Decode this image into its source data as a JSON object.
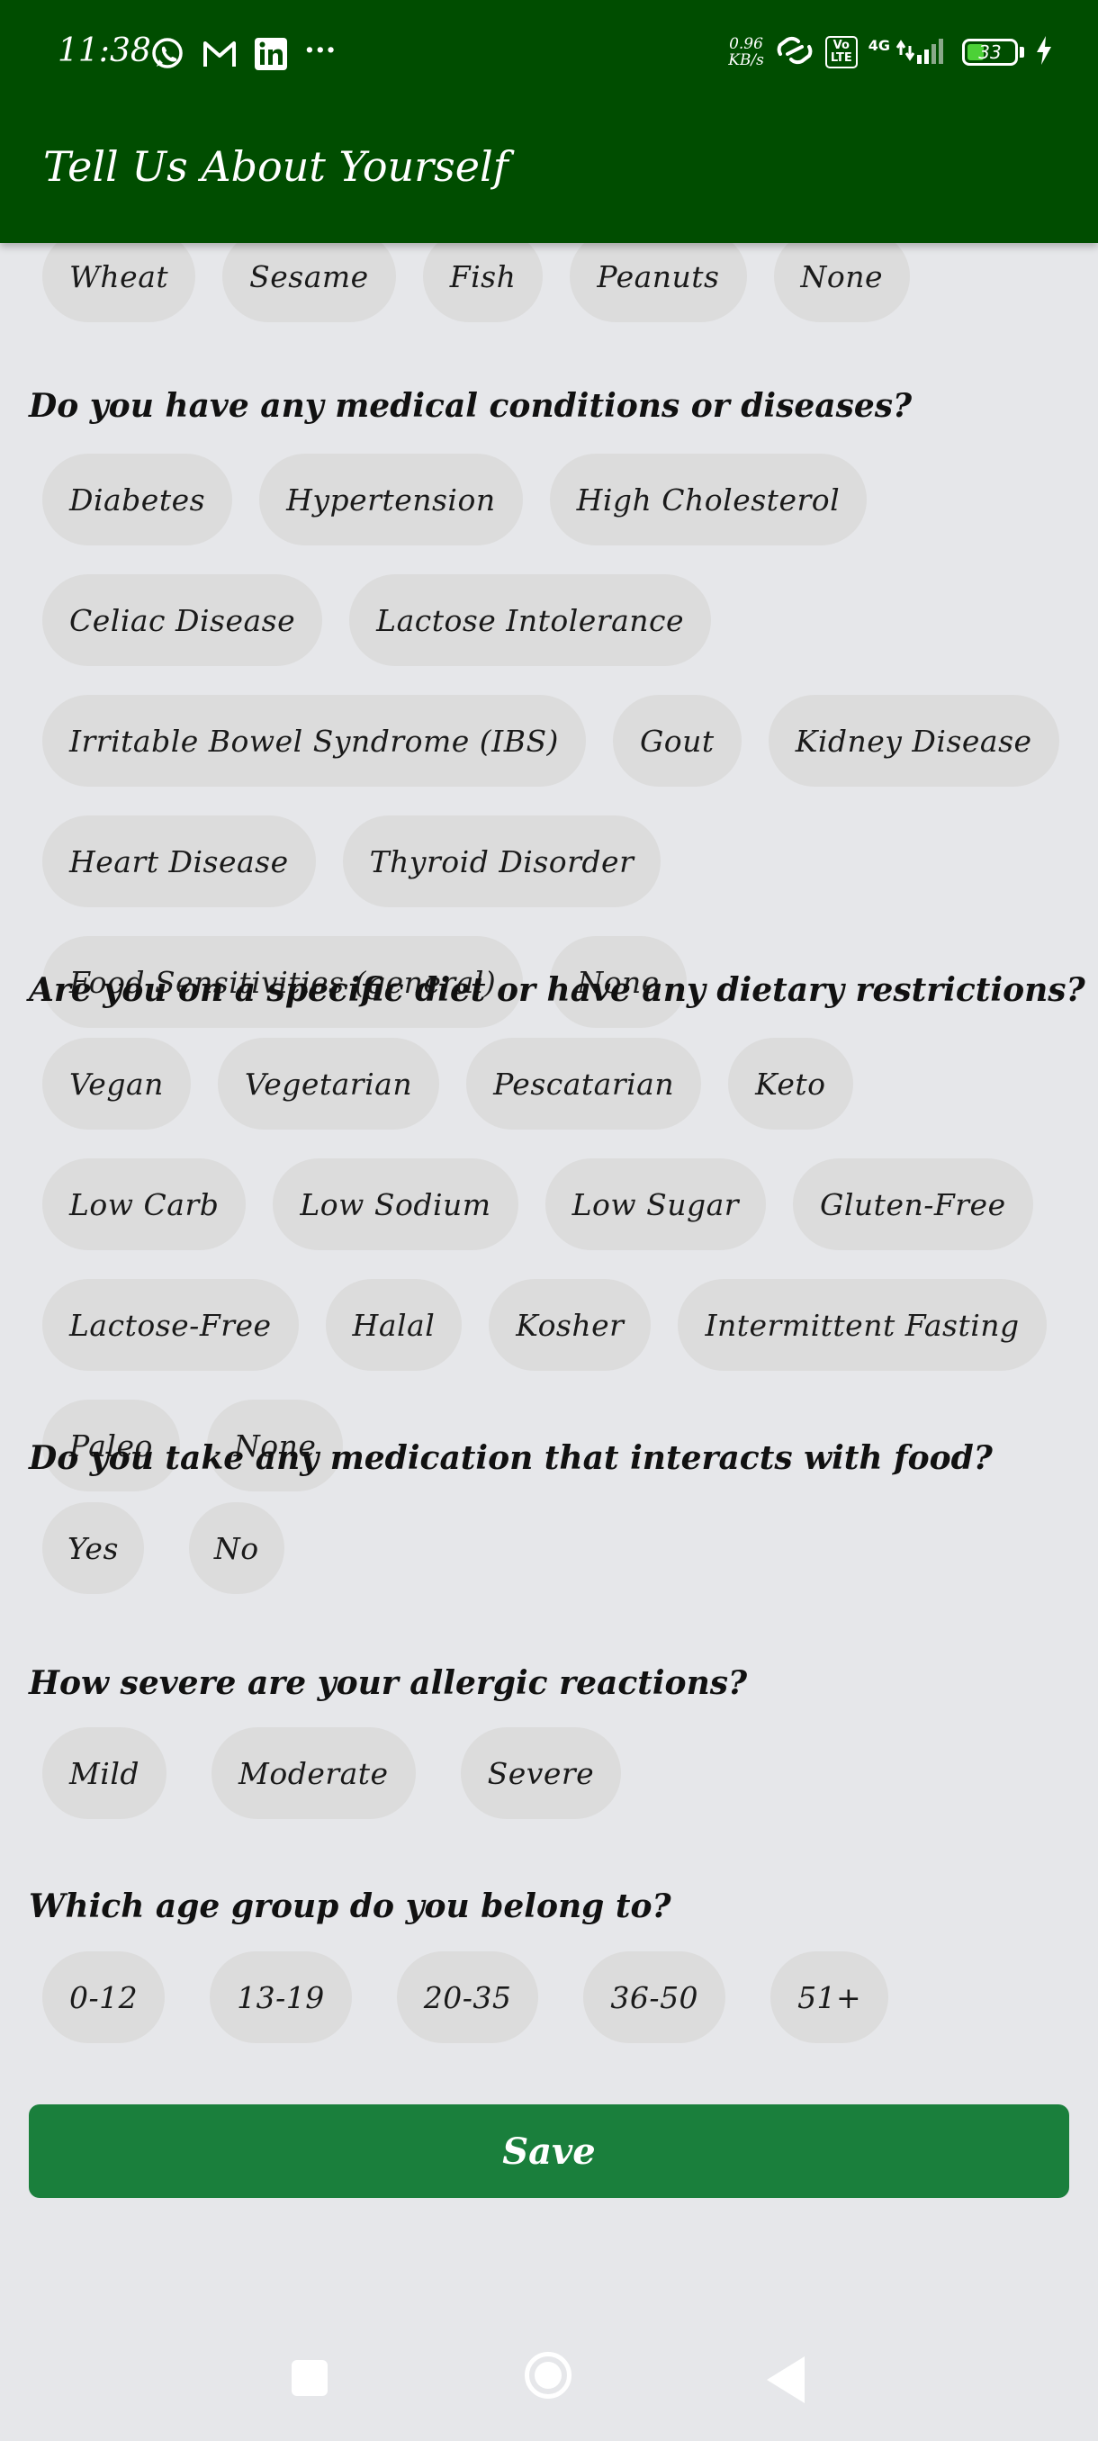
{
  "status_bar": {
    "time": "11:38",
    "more": "···",
    "net_speed_value": "0.96",
    "net_speed_unit": "KB/s",
    "volte_top": "Vo",
    "volte_bottom": "LTE",
    "network": "4G",
    "battery": "33",
    "battery_level": 0.33,
    "app_icons": [
      "whatsapp-icon",
      "gmail-icon",
      "linkedin-icon"
    ]
  },
  "app_bar": {
    "title": "Tell Us About Yourself"
  },
  "allergies_partial": {
    "options": [
      "Wheat",
      "Sesame",
      "Fish",
      "Peanuts",
      "None"
    ]
  },
  "medical": {
    "question": "Do you have any medical conditions or diseases?",
    "options": [
      "Diabetes",
      "Hypertension",
      "High Cholesterol",
      "Celiac Disease",
      "Lactose Intolerance",
      "Irritable Bowel Syndrome (IBS)",
      "Gout",
      "Kidney Disease",
      "Heart Disease",
      "Thyroid Disorder",
      "Food Sensitivities (general)",
      "None"
    ]
  },
  "diet": {
    "question": "Are you on a specific diet or have any dietary restrictions?",
    "options": [
      "Vegan",
      "Vegetarian",
      "Pescatarian",
      "Keto",
      "Low Carb",
      "Low Sodium",
      "Low Sugar",
      "Gluten-Free",
      "Lactose-Free",
      "Halal",
      "Kosher",
      "Intermittent Fasting",
      "Paleo",
      "None"
    ]
  },
  "medication": {
    "question": "Do you take any medication that interacts with food?",
    "options": [
      "Yes",
      "No"
    ]
  },
  "severity": {
    "question": "How severe are your allergic reactions?",
    "options": [
      "Mild",
      "Moderate",
      "Severe"
    ]
  },
  "age": {
    "question": "Which age group do you belong to?",
    "options": [
      "0-12",
      "13-19",
      "20-35",
      "36-50",
      "51+"
    ]
  },
  "save_label": "Save",
  "colors": {
    "app_bar": "#004d00",
    "save_button": "#1a7f3c",
    "chip": "#dcdcdc",
    "background": "#e6e7ea"
  }
}
